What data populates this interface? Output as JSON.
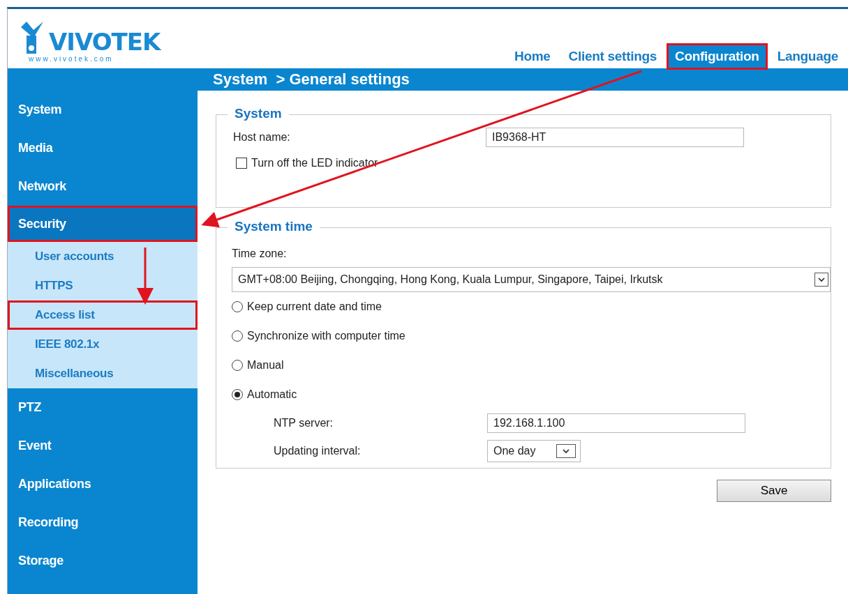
{
  "logo": {
    "wordmark": "VIVOTEK",
    "url": "www.vivotek.com"
  },
  "nav": [
    {
      "label": "Home",
      "selected": false,
      "highlighted": false
    },
    {
      "label": "Client settings",
      "selected": false,
      "highlighted": false
    },
    {
      "label": "Configuration",
      "selected": true,
      "highlighted": true
    },
    {
      "label": "Language",
      "selected": false,
      "highlighted": false
    }
  ],
  "breadcrumb": "System  > General settings",
  "sidebar": {
    "items": [
      {
        "label": "System",
        "selected": false,
        "highlighted": false
      },
      {
        "label": "Media",
        "selected": false,
        "highlighted": false
      },
      {
        "label": "Network",
        "selected": false,
        "highlighted": false
      },
      {
        "label": "Security",
        "selected": true,
        "highlighted": true,
        "children": [
          {
            "label": "User accounts",
            "highlighted": false
          },
          {
            "label": "HTTPS",
            "highlighted": false
          },
          {
            "label": "Access list",
            "highlighted": true
          },
          {
            "label": "IEEE 802.1x",
            "highlighted": false
          },
          {
            "label": "Miscellaneous",
            "highlighted": false
          }
        ]
      },
      {
        "label": "PTZ",
        "selected": false,
        "highlighted": false
      },
      {
        "label": "Event",
        "selected": false,
        "highlighted": false
      },
      {
        "label": "Applications",
        "selected": false,
        "highlighted": false
      },
      {
        "label": "Recording",
        "selected": false,
        "highlighted": false
      },
      {
        "label": "Storage",
        "selected": false,
        "highlighted": false
      }
    ]
  },
  "system": {
    "legend": "System",
    "host_label": "Host name:",
    "host_value": "IB9368-HT",
    "led_label": "Turn off the LED indicator",
    "led_checked": false
  },
  "system_time": {
    "legend": "System time",
    "timezone_label": "Time zone:",
    "timezone_value": "GMT+08:00 Beijing, Chongqing, Hong Kong, Kuala Lumpur, Singapore, Taipei, Irkutsk",
    "options": [
      {
        "label": "Keep current date and time",
        "selected": false
      },
      {
        "label": "Synchronize with computer time",
        "selected": false
      },
      {
        "label": "Manual",
        "selected": false
      },
      {
        "label": "Automatic",
        "selected": true
      }
    ],
    "ntp_label": "NTP server:",
    "ntp_value": "192.168.1.100",
    "interval_label": "Updating interval:",
    "interval_value": "One day"
  },
  "save_button": "Save"
}
